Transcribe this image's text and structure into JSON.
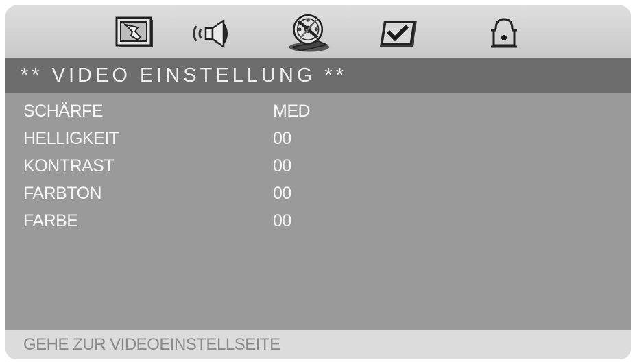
{
  "menu": {
    "icons": [
      {
        "name": "general-setup-icon",
        "selected": false
      },
      {
        "name": "audio-setup-icon",
        "selected": false
      },
      {
        "name": "video-setup-icon",
        "selected": true
      },
      {
        "name": "preferences-icon",
        "selected": false
      },
      {
        "name": "password-lock-icon",
        "selected": false
      }
    ]
  },
  "title": "** VIDEO EINSTELLUNG **",
  "settings": [
    {
      "label": "SCHÄRFE",
      "value": "MED"
    },
    {
      "label": "HELLIGKEIT",
      "value": "00"
    },
    {
      "label": "KONTRAST",
      "value": "00"
    },
    {
      "label": "FARBTON",
      "value": "00"
    },
    {
      "label": "FARBE",
      "value": "00"
    }
  ],
  "status": "GEHE ZUR VIDEOEINSTELLSEITE",
  "colors": {
    "panel": "#9a9a9a",
    "title_bar": "#6d6d6d",
    "top_bar": "#d4d4d4",
    "status_bar": "#dcdcdc",
    "text": "#f5f5f5"
  }
}
